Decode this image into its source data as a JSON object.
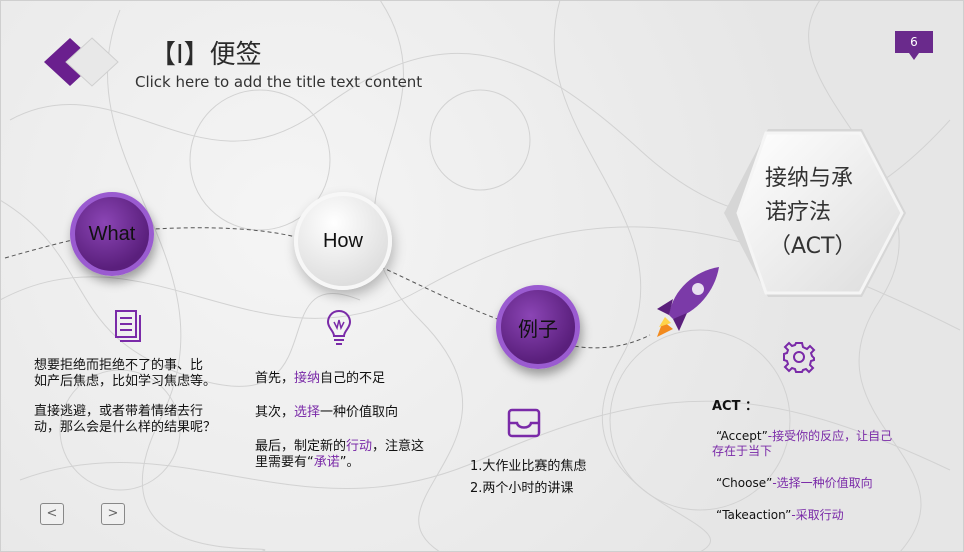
{
  "page": {
    "title": "【I】便签",
    "subtitle": "Click here to add the title text content",
    "page_number": "6"
  },
  "nodes": {
    "what": "What",
    "how": "How",
    "example": "例子",
    "act_hex": [
      "接纳与承",
      "诺疗法",
      "（ACT）"
    ]
  },
  "what_text": {
    "line1": "想要拒绝而拒绝不了的事、比",
    "line2": "如产后焦虑，比如学习焦虑等。",
    "line3": "直接逃避，或者带着情绪去行",
    "line4": "动，那么会是什么样的结果呢？"
  },
  "how_text": {
    "p1_pre": "首先，",
    "p1_hl": "接纳",
    "p1_post": "自己的不足",
    "p2_pre": "其次，",
    "p2_hl": "选择",
    "p2_post": "一种价值取向",
    "p3_pre": "最后，制定新的",
    "p3_hl": "行动",
    "p3_post": "，注意这",
    "p4_pre": "里需要有“",
    "p4_hl": "承诺",
    "p4_post": "”。"
  },
  "example_text": {
    "line1": "1.大作业比赛的焦虑",
    "line2": "2.两个小时的讲课"
  },
  "act": {
    "heading": "ACT ：",
    "accept_key": "“Accept”",
    "accept_val_1": "-接受你的反应，让自己",
    "accept_val_2": "存在于当下",
    "choose_key": "“Choose”",
    "choose_val": "-选择一种价值取向",
    "take_key": "“Takeaction”",
    "take_val": "-采取行动"
  },
  "nav": {
    "prev": "<",
    "next": ">"
  },
  "colors": {
    "accent": "#7a2aa8",
    "accent_dark": "#5a1f7c",
    "background": "#ececec"
  }
}
